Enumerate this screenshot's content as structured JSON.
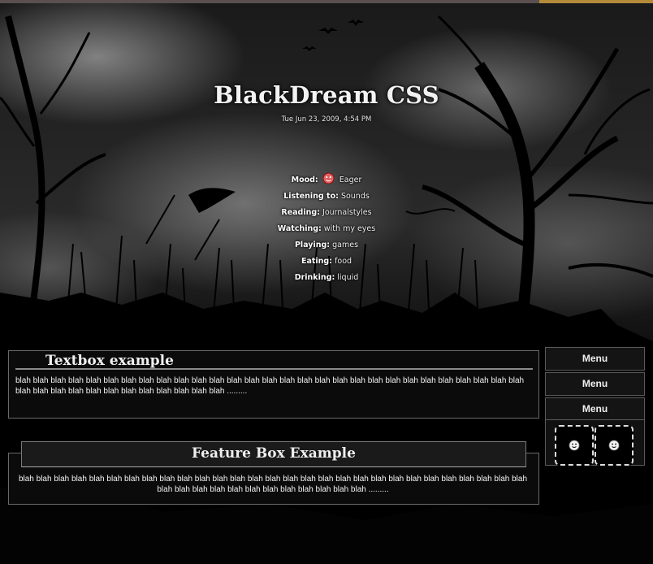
{
  "site": {
    "title": "BlackDream CSS",
    "timestamp": "Tue Jun 23, 2009, 4:54 PM"
  },
  "status": [
    {
      "label": "Mood:",
      "value": "Eager",
      "icon": "eager-mood-icon"
    },
    {
      "label": "Listening to:",
      "value": "Sounds"
    },
    {
      "label": "Reading:",
      "value": "Journalstyles"
    },
    {
      "label": "Watching:",
      "value": "with my eyes"
    },
    {
      "label": "Playing:",
      "value": "games"
    },
    {
      "label": "Eating:",
      "value": "food"
    },
    {
      "label": "Drinking:",
      "value": "liquid"
    }
  ],
  "textbox": {
    "title": "Textbox example",
    "body": "blah blah blah blah blah blah blah blah blah blah blah blah blah blah blah blah blah blah blah blah blah blah blah blah blah blah blah blah blah blah blah blah blah blah blah blah blah blah blah blah blah ........."
  },
  "featurebox": {
    "title": "Feature Box Example",
    "body": "blah blah blah blah blah blah blah blah blah blah blah blah blah blah blah blah blah blah blah blah blah blah blah blah blah blah blah blah blah blah blah blah blah blah blah blah blah blah blah blah blah ........."
  },
  "menu": [
    "Menu",
    "Menu",
    "Menu"
  ],
  "avatars": [
    "smiley-icon",
    "smiley-icon"
  ],
  "colors": {
    "background": "#0b0b0b",
    "panel": "#0c0c0c",
    "border": "#6a6a6a",
    "text": "#f0f0f0"
  }
}
